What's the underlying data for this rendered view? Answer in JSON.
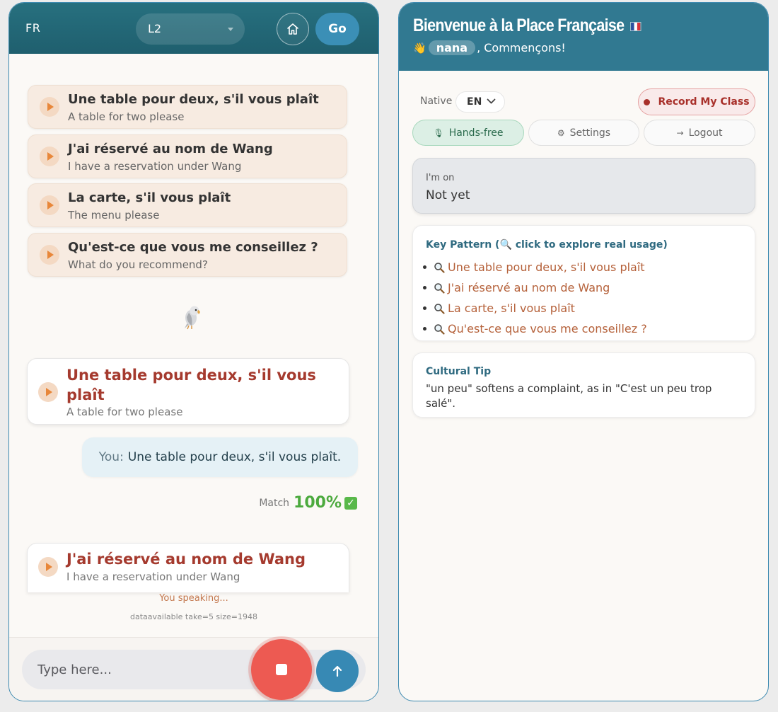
{
  "left": {
    "header": {
      "lang_code": "FR",
      "level": "L2",
      "go_label": "Go"
    },
    "phrases": [
      {
        "fr": "Une table pour deux, s'il vous plaît",
        "en": "A table for two please"
      },
      {
        "fr": "J'ai réservé au nom de Wang",
        "en": "I have a reservation under Wang"
      },
      {
        "fr": "La carte, s'il vous plaît",
        "en": "The menu please"
      },
      {
        "fr": "Qu'est-ce que vous me conseillez ?",
        "en": "What do you recommend?"
      }
    ],
    "chat": {
      "prompt1": {
        "fr_line1": "Une table pour deux, s'il vous",
        "fr_line2": "plaît",
        "en": "A table for two please"
      },
      "user_prefix": "You:",
      "user_text": "Une table pour deux, s'il vous plaît.",
      "match_label": "Match",
      "match_pct": "100%",
      "prompt2": {
        "fr": "J'ai réservé au nom de Wang",
        "en": "I have a reservation under Wang"
      }
    },
    "status": {
      "speaking": "You speaking...",
      "debug": "dataavailable take=5 size=1948"
    },
    "input": {
      "placeholder": "Type here..."
    }
  },
  "right": {
    "header": {
      "title": "Bienvenue à la Place Française",
      "wave": "👋",
      "name": "nana",
      "greeting": ", Commençons!"
    },
    "native_label": "Native",
    "native_value": "EN",
    "record_label": "Record My Class",
    "handsfree_icon": "🎙",
    "handsfree_label": "Hands-free",
    "settings_icon": "⚙",
    "settings_label": "Settings",
    "logout_icon": "→",
    "logout_label": "Logout",
    "imon": {
      "label": "I'm on",
      "value": "Not yet"
    },
    "key_pattern": {
      "title": "Key Pattern (🔍 click to explore real usage)",
      "items": [
        "Une table pour deux, s'il vous plaît",
        "J'ai réservé au nom de Wang",
        "La carte, s'il vous plaît",
        "Qu'est-ce que vous me conseillez ?"
      ]
    },
    "cultural_tip": {
      "title": "Cultural Tip",
      "text": "\"un peu\" softens a complaint, as in \"C'est un peu trop salé\"."
    }
  },
  "colors": {
    "header_teal": "#27707f",
    "accent_blue": "#3789b4",
    "phrase_bg": "#f7ebe1",
    "prompt_red": "#a53a2e",
    "match_green": "#4caa3e",
    "stop_red": "#ed5a52"
  }
}
